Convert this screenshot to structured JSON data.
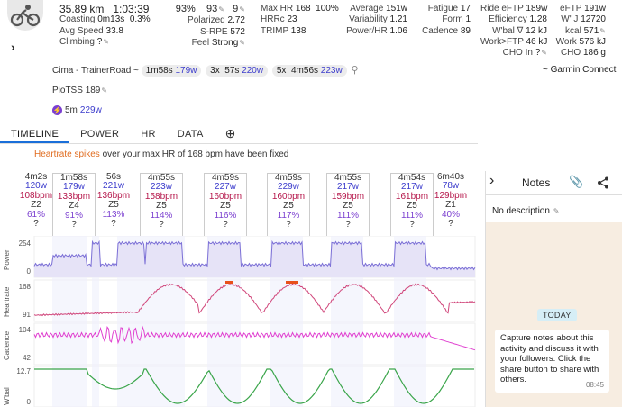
{
  "stats": {
    "col1": [
      {
        "label": "",
        "value": "35.89 km",
        "extra": "1:03:39"
      },
      {
        "label": "Coasting",
        "value": "0m13s",
        "extra": "0.3%"
      },
      {
        "label": "Avg Speed",
        "value": "33.8",
        "extra": ""
      },
      {
        "label": "Climbing",
        "value": "?",
        "extra": ""
      }
    ],
    "col2": [
      {
        "label": "",
        "value": "93%",
        "extra1": "93",
        "extra2": "9"
      },
      {
        "label": "Polarized",
        "value": "2.72"
      },
      {
        "label": "S-RPE",
        "value": "572"
      },
      {
        "label": "Feel",
        "value": "Strong"
      }
    ],
    "col3": [
      {
        "label": "Max HR",
        "value": "168",
        "extra": "100%"
      },
      {
        "label": "HRRc",
        "value": "23"
      },
      {
        "label": "TRIMP",
        "value": "138"
      }
    ],
    "col4": [
      {
        "label": "Average",
        "value": "151w"
      },
      {
        "label": "Variability",
        "value": "1.21"
      },
      {
        "label": "Power/HR",
        "value": "1.06"
      }
    ],
    "col5": [
      {
        "label": "Fatigue",
        "value": "17"
      },
      {
        "label": "Form",
        "value": "1"
      },
      {
        "label": "Cadence",
        "value": "89"
      }
    ],
    "col6": [
      {
        "label": "Ride eFTP",
        "value": "189w"
      },
      {
        "label": "Efficiency",
        "value": "1.28"
      },
      {
        "label": "W'bal ∇",
        "value": "12 kJ"
      },
      {
        "label": "Work>FTP",
        "value": "46 kJ"
      },
      {
        "label": "CHO In",
        "value": "?"
      }
    ],
    "col7": [
      {
        "label": "eFTP",
        "value": "191w"
      },
      {
        "label": "W' J",
        "value": "12720"
      },
      {
        "label": "kcal",
        "value": "571"
      },
      {
        "label": "Work",
        "value": "576 kJ"
      },
      {
        "label": "CHO",
        "value": "186 g"
      }
    ]
  },
  "garmin": "~ Garmin Connect",
  "intervals": {
    "name": "Cima - TrainerRoad",
    "tilde": "~",
    "chips": [
      {
        "count": "",
        "dur": "1m58s",
        "watts": "179w"
      },
      {
        "count": "3x",
        "dur": "57s",
        "watts": "220w"
      },
      {
        "count": "5x",
        "dur": "4m56s",
        "watts": "223w"
      }
    ]
  },
  "pio_tss": {
    "label": "PioTSS",
    "value": "189"
  },
  "five_min": {
    "label": "5m",
    "value": "229w"
  },
  "tabs": [
    "TIMELINE",
    "POWER",
    "HR",
    "DATA"
  ],
  "active_tab": "TIMELINE",
  "warning": {
    "highlight": "Heartrate spikes",
    "text": "over your max HR of 168 bpm have been fixed"
  },
  "interval_cols": [
    {
      "dur": "4m2s",
      "w": "120w",
      "bpm": "108bpm",
      "zone": "Z2",
      "pct": "61%",
      "q": "?"
    },
    {
      "dur": "1m58s",
      "w": "179w",
      "bpm": "133bpm",
      "zone": "Z4",
      "pct": "91%",
      "q": "?"
    },
    {
      "dur": "56s",
      "w": "221w",
      "bpm": "136bpm",
      "zone": "Z5",
      "pct": "113%",
      "q": "?"
    },
    {
      "dur": "4m55s",
      "w": "223w",
      "bpm": "158bpm",
      "zone": "Z5",
      "pct": "114%",
      "q": "?"
    },
    {
      "dur": "4m59s",
      "w": "227w",
      "bpm": "160bpm",
      "zone": "Z5",
      "pct": "116%",
      "q": "?"
    },
    {
      "dur": "4m59s",
      "w": "229w",
      "bpm": "160bpm",
      "zone": "Z5",
      "pct": "117%",
      "q": "?"
    },
    {
      "dur": "4m55s",
      "w": "217w",
      "bpm": "159bpm",
      "zone": "Z5",
      "pct": "111%",
      "q": "?"
    },
    {
      "dur": "4m54s",
      "w": "217w",
      "bpm": "161bpm",
      "zone": "Z5",
      "pct": "111%",
      "q": "?"
    },
    {
      "dur": "6m40s",
      "w": "78w",
      "bpm": "129bpm",
      "zone": "Z1",
      "pct": "40%",
      "q": "?"
    }
  ],
  "charts": {
    "power": {
      "label": "Power",
      "max": "254",
      "min": "0"
    },
    "heartrate": {
      "label": "Heartrate",
      "max": "168",
      "min": "91"
    },
    "cadence": {
      "label": "Cadence",
      "max": "104",
      "min": "42"
    },
    "wbal": {
      "label": "W'bal",
      "max": "12.7",
      "min": "0"
    }
  },
  "notes": {
    "title": "Notes",
    "description": "No description",
    "today": "TODAY",
    "bubble": "Capture notes about this activity and discuss it with your followers. Click the share button to share with others.",
    "time": "08:45"
  },
  "colors": {
    "power": "#7b6fd6",
    "hr": "#d0457a",
    "cadence": "#e040d0",
    "wbal": "#3aa54a",
    "accent": "#1a6fd9"
  }
}
